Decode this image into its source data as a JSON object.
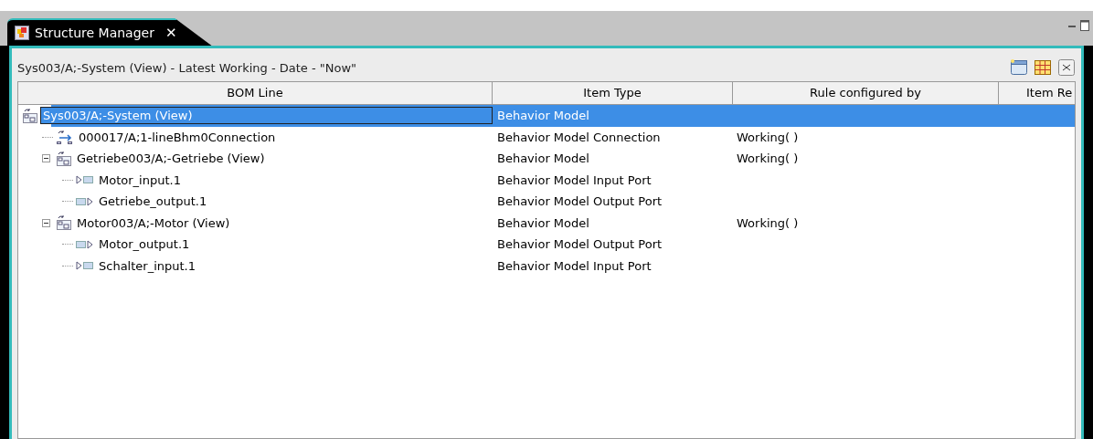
{
  "tab": {
    "title": "Structure Manager",
    "close": "✕",
    "selected": true
  },
  "panel": {
    "title": "Sys003/A;-System (View) - Latest Working - Date - \"Now\""
  },
  "table": {
    "columns": [
      "BOM Line",
      "Item Type",
      "Rule configured by",
      "Item Re"
    ],
    "rows": [
      {
        "kind": "model",
        "label": "Sys003/A;-System (View)",
        "item_type": "Behavior Model",
        "selected": true,
        "children": [
          {
            "kind": "connection",
            "label": "000017/A;1-lineBhm0Connection",
            "item_type": "Behavior Model Connection",
            "rule": "Working( )",
            "selected": false
          },
          {
            "kind": "model",
            "label": "Getriebe003/A;-Getriebe (View)",
            "item_type": "Behavior Model",
            "rule": "Working( )",
            "selected": false,
            "expanded": true,
            "children": [
              {
                "kind": "input",
                "label": "Motor_input.1",
                "item_type": "Behavior Model Input Port",
                "selected": false
              },
              {
                "kind": "output",
                "label": "Getriebe_output.1",
                "item_type": "Behavior Model Output Port",
                "selected": false
              }
            ]
          },
          {
            "kind": "model",
            "label": "Motor003/A;-Motor (View)",
            "item_type": "Behavior Model",
            "rule": "Working( )",
            "selected": false,
            "expanded": true,
            "children": [
              {
                "kind": "output",
                "label": "Motor_output.1",
                "item_type": "Behavior Model Output Port",
                "selected": false
              },
              {
                "kind": "input",
                "label": "Schalter_input.1",
                "item_type": "Behavior Model Input Port",
                "selected": false
              }
            ]
          }
        ]
      }
    ]
  }
}
